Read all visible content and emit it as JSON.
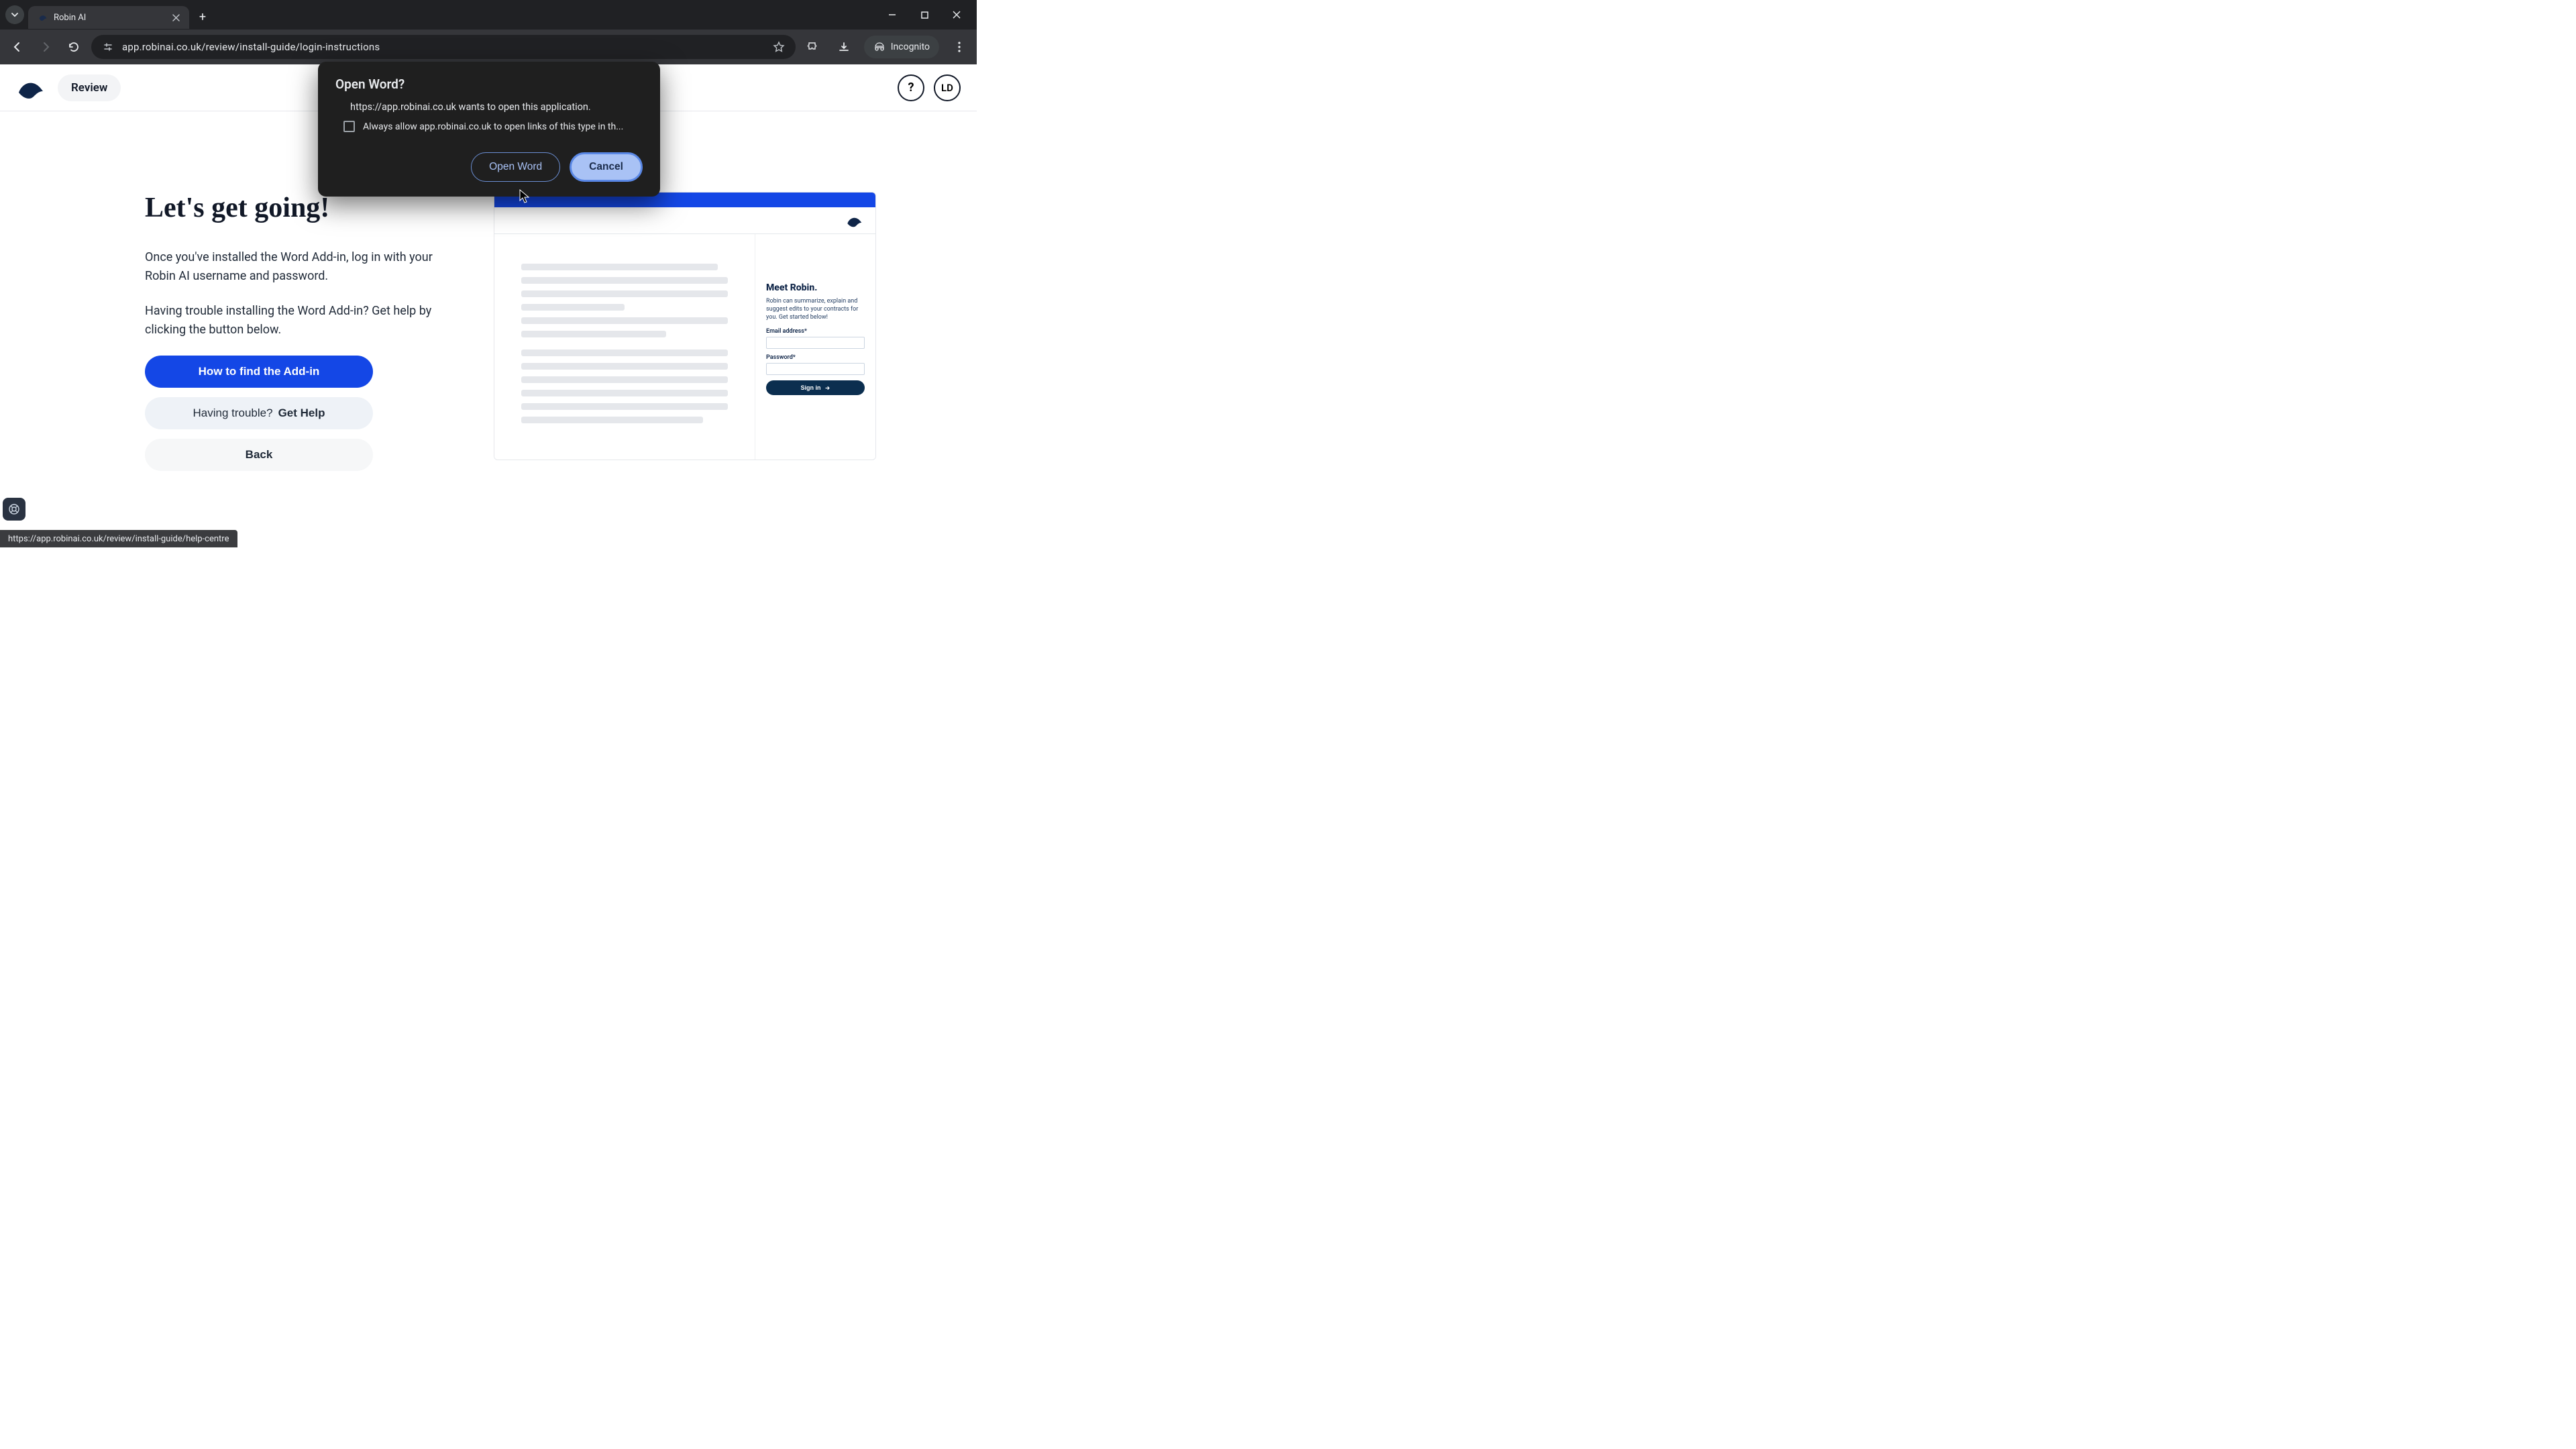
{
  "browser": {
    "tab_title": "Robin AI",
    "url": "app.robinai.co.uk/review/install-guide/login-instructions",
    "incognito_label": "Incognito",
    "status_url": "https://app.robinai.co.uk/review/install-guide/help-centre"
  },
  "header": {
    "review_label": "Review",
    "help_glyph": "?",
    "avatar_initials": "LD"
  },
  "main": {
    "heading": "Let's get going!",
    "para1": "Once you've installed the Word Add-in, log in with your Robin AI username and password.",
    "para2": "Having trouble installing the Word Add-in? Get help by clicking the button below.",
    "btn_primary": "How to find the Add-in",
    "btn_secondary_prefix": "Having trouble?",
    "btn_secondary_bold": "Get Help",
    "btn_back": "Back"
  },
  "preview": {
    "meet_title": "Meet Robin.",
    "meet_desc": "Robin can summarize, explain and suggest edits to your contracts for you. Get started below!",
    "email_label": "Email address*",
    "password_label": "Password*",
    "signin_label": "Sign in"
  },
  "modal": {
    "title": "Open Word?",
    "message": "https://app.robinai.co.uk wants to open this application.",
    "checkbox_label": "Always allow app.robinai.co.uk to open links of this type in th...",
    "open_label": "Open Word",
    "cancel_label": "Cancel"
  }
}
